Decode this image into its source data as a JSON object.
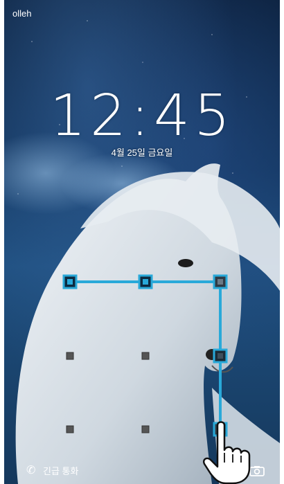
{
  "status_bar": {
    "carrier": "olleh"
  },
  "lock": {
    "time": "12:45",
    "date": "4월 25일 금요일"
  },
  "bottom": {
    "emergency_call_label": "긴급 통화"
  },
  "icons": {
    "phone": "phone-icon",
    "camera": "camera-icon",
    "hand_pointer": "hand-pointer-icon"
  },
  "colors": {
    "pattern_line": "#29a9d9",
    "pattern_node_active": "#29a9d9",
    "pattern_node_idle": "#555555"
  },
  "pattern": {
    "grid_size": 3,
    "selected_nodes": [
      1,
      2,
      3,
      6,
      9
    ]
  }
}
